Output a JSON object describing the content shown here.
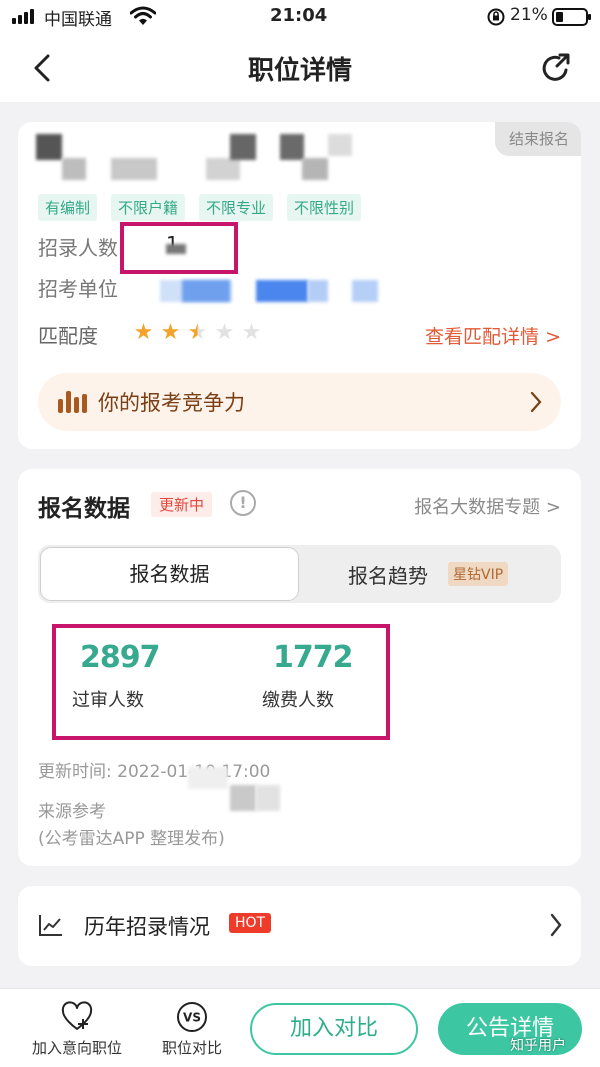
{
  "status_bar": {
    "carrier": "中国联通",
    "time": "21:04",
    "battery": "21%"
  },
  "nav": {
    "title": "职位详情"
  },
  "position": {
    "status_badge": "结束报名",
    "tags": [
      "有编制",
      "不限户籍",
      "不限专业",
      "不限性别"
    ],
    "recruit_label": "招录人数",
    "recruit_value": "1",
    "unit_label": "招考单位",
    "match_label": "匹配度",
    "match_rating": 2.5,
    "match_max": 5,
    "match_link": "查看匹配详情 >",
    "competition_label": "你的报考竞争力"
  },
  "registration": {
    "title": "报名数据",
    "status_badge": "更新中",
    "bigdata_link": "报名大数据专题 >",
    "tabs": [
      {
        "label": "报名数据"
      },
      {
        "label": "报名趋势",
        "badge": "星钻VIP"
      }
    ],
    "stats": [
      {
        "value": "2897",
        "label": "过审人数"
      },
      {
        "value": "1772",
        "label": "缴费人数"
      }
    ],
    "update_time": "更新时间: 2022-01-10 17:00",
    "source_line1": "来源参考",
    "source_line2": "(公考雷达APP 整理发布)"
  },
  "history": {
    "label": "历年招录情况",
    "badge": "HOT"
  },
  "bottom_bar": {
    "favorite_label": "加入意向职位",
    "compare_tool_label": "职位对比",
    "compare_icon_text": "VS",
    "add_compare_button": "加入对比",
    "notice_button": "公告详情"
  },
  "watermark": "知乎用户",
  "colors": {
    "accent": "#3cc7a2",
    "stat_green": "#36a98e",
    "highlight_box": "#c8156c",
    "link_orange": "#e25a37",
    "hot_red": "#ee3b2a"
  }
}
